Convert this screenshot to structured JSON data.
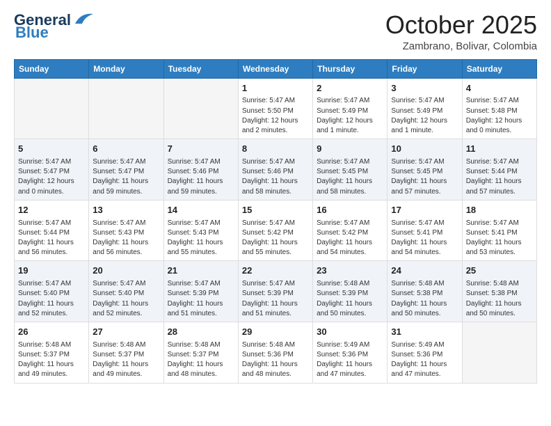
{
  "logo": {
    "line1": "General",
    "line2": "Blue"
  },
  "title": "October 2025",
  "subtitle": "Zambrano, Bolivar, Colombia",
  "headers": [
    "Sunday",
    "Monday",
    "Tuesday",
    "Wednesday",
    "Thursday",
    "Friday",
    "Saturday"
  ],
  "weeks": [
    [
      {
        "day": "",
        "text": ""
      },
      {
        "day": "",
        "text": ""
      },
      {
        "day": "",
        "text": ""
      },
      {
        "day": "1",
        "text": "Sunrise: 5:47 AM\nSunset: 5:50 PM\nDaylight: 12 hours\nand 2 minutes."
      },
      {
        "day": "2",
        "text": "Sunrise: 5:47 AM\nSunset: 5:49 PM\nDaylight: 12 hours\nand 1 minute."
      },
      {
        "day": "3",
        "text": "Sunrise: 5:47 AM\nSunset: 5:49 PM\nDaylight: 12 hours\nand 1 minute."
      },
      {
        "day": "4",
        "text": "Sunrise: 5:47 AM\nSunset: 5:48 PM\nDaylight: 12 hours\nand 0 minutes."
      }
    ],
    [
      {
        "day": "5",
        "text": "Sunrise: 5:47 AM\nSunset: 5:47 PM\nDaylight: 12 hours\nand 0 minutes."
      },
      {
        "day": "6",
        "text": "Sunrise: 5:47 AM\nSunset: 5:47 PM\nDaylight: 11 hours\nand 59 minutes."
      },
      {
        "day": "7",
        "text": "Sunrise: 5:47 AM\nSunset: 5:46 PM\nDaylight: 11 hours\nand 59 minutes."
      },
      {
        "day": "8",
        "text": "Sunrise: 5:47 AM\nSunset: 5:46 PM\nDaylight: 11 hours\nand 58 minutes."
      },
      {
        "day": "9",
        "text": "Sunrise: 5:47 AM\nSunset: 5:45 PM\nDaylight: 11 hours\nand 58 minutes."
      },
      {
        "day": "10",
        "text": "Sunrise: 5:47 AM\nSunset: 5:45 PM\nDaylight: 11 hours\nand 57 minutes."
      },
      {
        "day": "11",
        "text": "Sunrise: 5:47 AM\nSunset: 5:44 PM\nDaylight: 11 hours\nand 57 minutes."
      }
    ],
    [
      {
        "day": "12",
        "text": "Sunrise: 5:47 AM\nSunset: 5:44 PM\nDaylight: 11 hours\nand 56 minutes."
      },
      {
        "day": "13",
        "text": "Sunrise: 5:47 AM\nSunset: 5:43 PM\nDaylight: 11 hours\nand 56 minutes."
      },
      {
        "day": "14",
        "text": "Sunrise: 5:47 AM\nSunset: 5:43 PM\nDaylight: 11 hours\nand 55 minutes."
      },
      {
        "day": "15",
        "text": "Sunrise: 5:47 AM\nSunset: 5:42 PM\nDaylight: 11 hours\nand 55 minutes."
      },
      {
        "day": "16",
        "text": "Sunrise: 5:47 AM\nSunset: 5:42 PM\nDaylight: 11 hours\nand 54 minutes."
      },
      {
        "day": "17",
        "text": "Sunrise: 5:47 AM\nSunset: 5:41 PM\nDaylight: 11 hours\nand 54 minutes."
      },
      {
        "day": "18",
        "text": "Sunrise: 5:47 AM\nSunset: 5:41 PM\nDaylight: 11 hours\nand 53 minutes."
      }
    ],
    [
      {
        "day": "19",
        "text": "Sunrise: 5:47 AM\nSunset: 5:40 PM\nDaylight: 11 hours\nand 52 minutes."
      },
      {
        "day": "20",
        "text": "Sunrise: 5:47 AM\nSunset: 5:40 PM\nDaylight: 11 hours\nand 52 minutes."
      },
      {
        "day": "21",
        "text": "Sunrise: 5:47 AM\nSunset: 5:39 PM\nDaylight: 11 hours\nand 51 minutes."
      },
      {
        "day": "22",
        "text": "Sunrise: 5:47 AM\nSunset: 5:39 PM\nDaylight: 11 hours\nand 51 minutes."
      },
      {
        "day": "23",
        "text": "Sunrise: 5:48 AM\nSunset: 5:39 PM\nDaylight: 11 hours\nand 50 minutes."
      },
      {
        "day": "24",
        "text": "Sunrise: 5:48 AM\nSunset: 5:38 PM\nDaylight: 11 hours\nand 50 minutes."
      },
      {
        "day": "25",
        "text": "Sunrise: 5:48 AM\nSunset: 5:38 PM\nDaylight: 11 hours\nand 50 minutes."
      }
    ],
    [
      {
        "day": "26",
        "text": "Sunrise: 5:48 AM\nSunset: 5:37 PM\nDaylight: 11 hours\nand 49 minutes."
      },
      {
        "day": "27",
        "text": "Sunrise: 5:48 AM\nSunset: 5:37 PM\nDaylight: 11 hours\nand 49 minutes."
      },
      {
        "day": "28",
        "text": "Sunrise: 5:48 AM\nSunset: 5:37 PM\nDaylight: 11 hours\nand 48 minutes."
      },
      {
        "day": "29",
        "text": "Sunrise: 5:48 AM\nSunset: 5:36 PM\nDaylight: 11 hours\nand 48 minutes."
      },
      {
        "day": "30",
        "text": "Sunrise: 5:49 AM\nSunset: 5:36 PM\nDaylight: 11 hours\nand 47 minutes."
      },
      {
        "day": "31",
        "text": "Sunrise: 5:49 AM\nSunset: 5:36 PM\nDaylight: 11 hours\nand 47 minutes."
      },
      {
        "day": "",
        "text": ""
      }
    ]
  ]
}
